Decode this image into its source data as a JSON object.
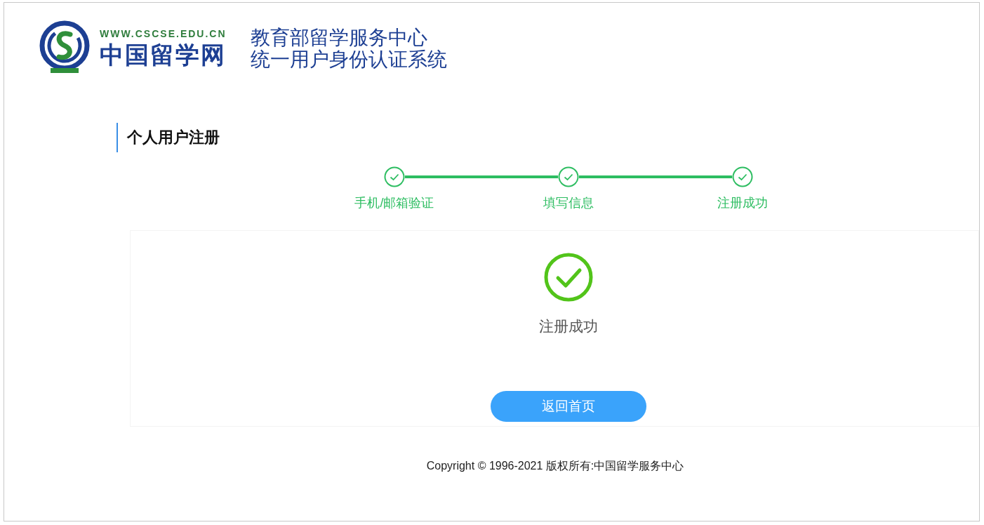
{
  "logo": {
    "url": "WWW.CSCSE.EDU.CN",
    "name": "中国留学网"
  },
  "header": {
    "title_lines": [
      "教育部留学服务中心",
      "统一用户身份认证系统"
    ]
  },
  "page_title": "个人用户注册",
  "steps": [
    {
      "label": "手机/邮箱验证",
      "done": true
    },
    {
      "label": "填写信息",
      "done": true
    },
    {
      "label": "注册成功",
      "done": true
    }
  ],
  "result": {
    "message": "注册成功",
    "success": true
  },
  "home_button": "返回首页",
  "footer": "Copyright © 1996-2021 版权所有:中国留学服务中心"
}
